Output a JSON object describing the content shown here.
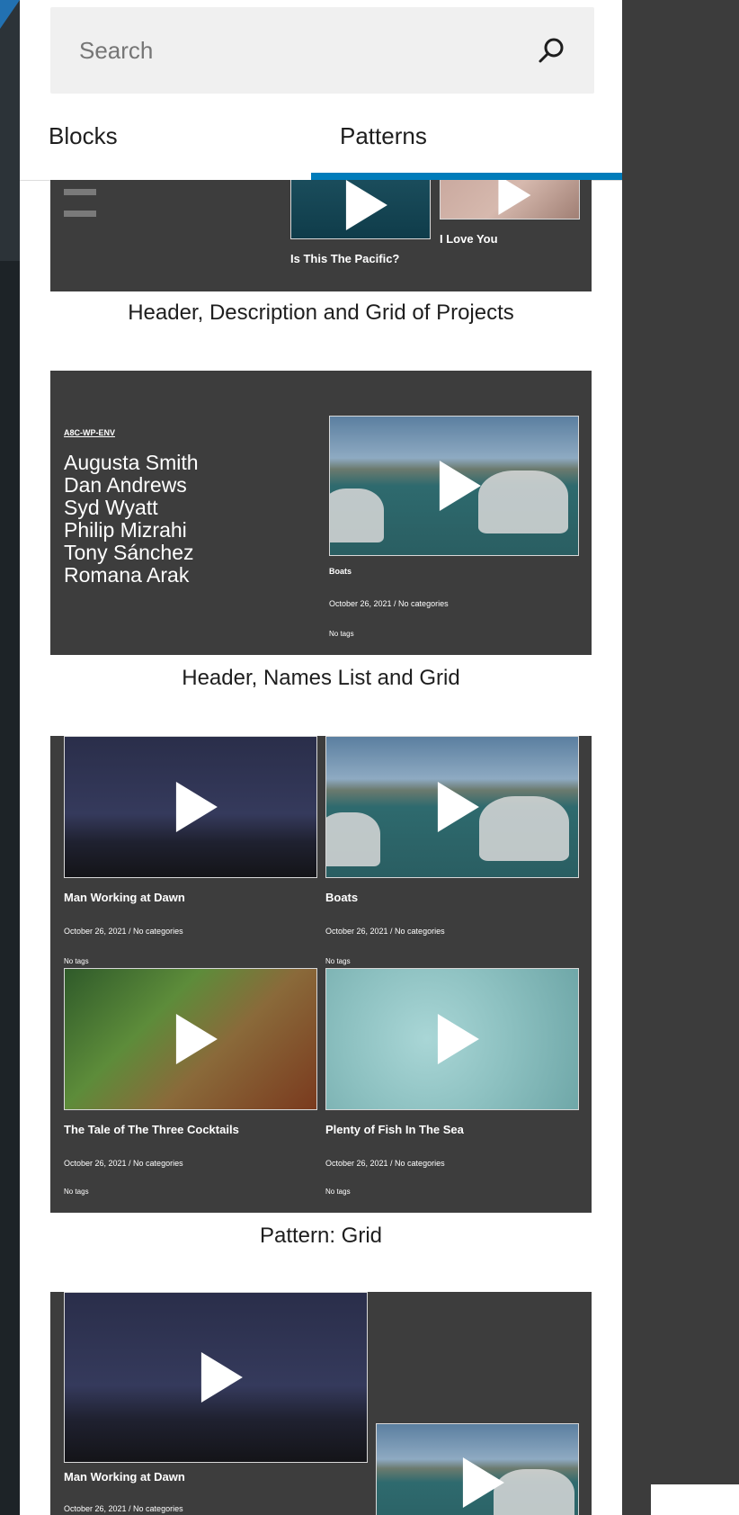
{
  "search": {
    "placeholder": "Search"
  },
  "tabs": [
    {
      "label": "Blocks"
    },
    {
      "label": "Patterns"
    }
  ],
  "active_tab": "Patterns",
  "patterns": [
    {
      "title": "Header, Description and Grid of Projects",
      "posts": [
        {
          "title": "Is This The Pacific?"
        },
        {
          "title": "I Love You"
        }
      ]
    },
    {
      "title": "Header, Names List and Grid",
      "site_title": "A8C-WP-ENV",
      "names": [
        "Augusta Smith",
        "Dan Andrews",
        "Syd Wyatt",
        "Philip Mizrahi",
        "Tony Sánchez",
        "Romana Arak"
      ],
      "post": {
        "title": "Boats",
        "meta": "October 26, 2021  /  No categories",
        "tags": "No tags"
      }
    },
    {
      "title": "Pattern: Grid",
      "posts": [
        {
          "title": "Man Working at Dawn",
          "meta": "October 26, 2021  /  No categories",
          "tags": "No tags"
        },
        {
          "title": "Boats",
          "meta": "October 26, 2021  /  No categories",
          "tags": "No tags"
        },
        {
          "title": "The Tale of The Three Cocktails",
          "meta": "October 26, 2021  /  No categories",
          "tags": "No tags"
        },
        {
          "title": "Plenty of Fish In The Sea",
          "meta": "October 26, 2021  /  No categories",
          "tags": "No tags"
        }
      ]
    },
    {
      "posts": [
        {
          "title": "Man Working at Dawn",
          "meta": "October 26, 2021  /  No categories"
        }
      ]
    }
  ],
  "colors": {
    "accent": "#007cba",
    "preview_bg": "#3d3d3d",
    "search_bg": "#f0f0f0"
  }
}
